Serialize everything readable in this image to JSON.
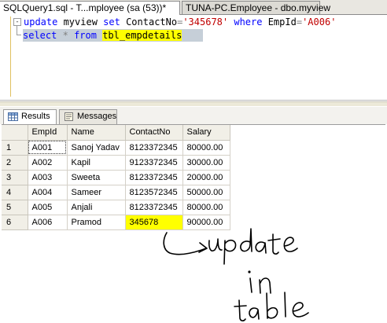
{
  "tabs": [
    {
      "label": "SQLQuery1.sql - T...mployee (sa (53))*",
      "active": true
    },
    {
      "label": "TUNA-PC.Employee - dbo.myview",
      "active": false
    }
  ],
  "editor": {
    "line1": {
      "kw1": "update",
      "t1": " myview ",
      "kw2": "set",
      "t2": " ContactNo",
      "op1": "=",
      "s1": "'345678'",
      "t3": " ",
      "kw3": "where",
      "t4": " EmpId",
      "op2": "=",
      "s2": "'A006'"
    },
    "line2": {
      "kw1": "select",
      "t1": " ",
      "op1": "*",
      "t2": " ",
      "kw2": "from",
      "t3": " ",
      "table": "tbl_empdetails"
    },
    "fold_symbol": "-"
  },
  "result_tabs": {
    "results": "Results",
    "messages": "Messages"
  },
  "grid": {
    "columns": [
      "EmpId",
      "Name",
      "ContactNo",
      "Salary"
    ],
    "rows": [
      {
        "n": "1",
        "empid": "A001",
        "name": "Sanoj Yadav",
        "contact": "8123372345",
        "salary": "80000.00"
      },
      {
        "n": "2",
        "empid": "A002",
        "name": "Kapil",
        "contact": "9123372345",
        "salary": "30000.00"
      },
      {
        "n": "3",
        "empid": "A003",
        "name": "Sweeta",
        "contact": "8123372345",
        "salary": "20000.00"
      },
      {
        "n": "4",
        "empid": "A004",
        "name": "Sameer",
        "contact": "8123572345",
        "salary": "50000.00"
      },
      {
        "n": "5",
        "empid": "A005",
        "name": "Anjali",
        "contact": "8123372345",
        "salary": "80000.00"
      },
      {
        "n": "6",
        "empid": "A006",
        "name": "Pramod",
        "contact": "345678",
        "salary": "90000.00"
      }
    ]
  },
  "annotation": {
    "lines": [
      "update",
      "in",
      "table"
    ],
    "color": "#000000"
  },
  "colors": {
    "highlight": "#ffff00",
    "keyword": "#0000ff",
    "string": "#c00000",
    "selection": "#c6cfd8"
  }
}
